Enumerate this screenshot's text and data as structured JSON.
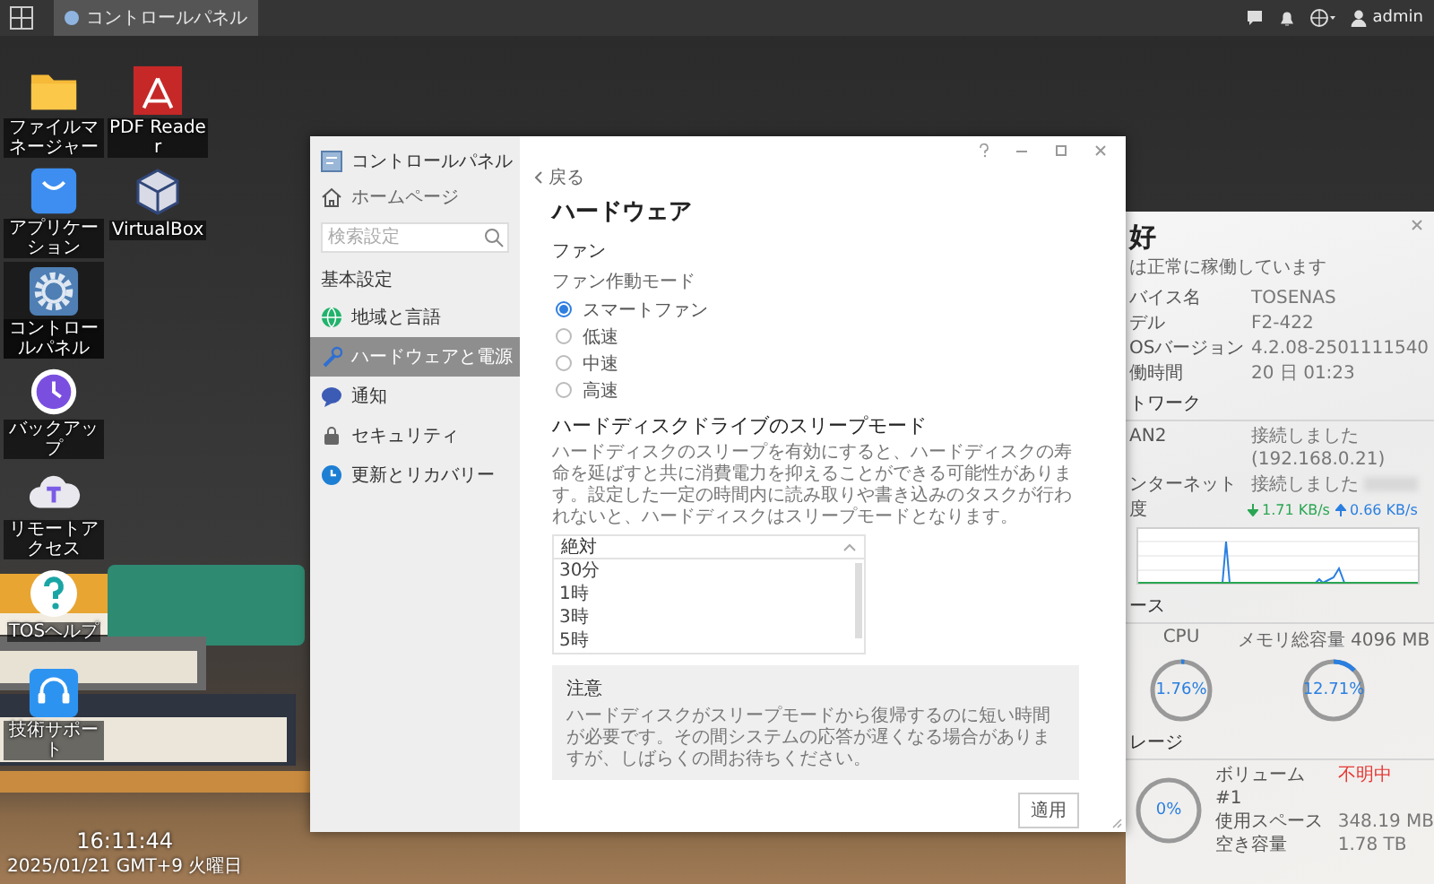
{
  "taskbar": {
    "open_app": "コントロールパネル",
    "user": "admin"
  },
  "desktop_icons": [
    {
      "label": "ファイルマネージャー",
      "kind": "folder",
      "selected": false
    },
    {
      "label": "アプリケーション",
      "kind": "store",
      "selected": false
    },
    {
      "label": "コントロールパネル",
      "kind": "gear",
      "selected": true
    },
    {
      "label": "バックアップ",
      "kind": "backup",
      "selected": false
    },
    {
      "label": "リモートアクセス",
      "kind": "cloud",
      "selected": false
    },
    {
      "label": "TOSヘルプ",
      "kind": "help",
      "selected": false
    },
    {
      "label": "技術サポート",
      "kind": "headset",
      "selected": false
    },
    {
      "label": "PDF Reader",
      "kind": "pdf",
      "selected": false
    },
    {
      "label": "VirtualBox",
      "kind": "cube",
      "selected": false
    }
  ],
  "clock": {
    "time": "16:11:44",
    "date": "2025/01/21 GMT+9 火曜日"
  },
  "control_panel": {
    "title": "コントロールパネル",
    "home": "ホームページ",
    "search_placeholder": "検索設定",
    "section": "基本設定",
    "nav": [
      {
        "label": "地域と言語",
        "kind": "globe",
        "selected": false
      },
      {
        "label": "ハードウェアと電源",
        "kind": "hardware",
        "selected": true
      },
      {
        "label": "通知",
        "kind": "chat",
        "selected": false
      },
      {
        "label": "セキュリティ",
        "kind": "lock",
        "selected": false
      },
      {
        "label": "更新とリカバリー",
        "kind": "update",
        "selected": false
      }
    ],
    "back": "戻る",
    "heading": "ハードウェア",
    "fan": {
      "title": "ファン",
      "mode_label": "ファン作動モード",
      "options": [
        {
          "label": "スマートファン",
          "selected": true
        },
        {
          "label": "低速",
          "selected": false
        },
        {
          "label": "中速",
          "selected": false
        },
        {
          "label": "高速",
          "selected": false
        }
      ]
    },
    "sleep": {
      "title": "ハードディスクドライブのスリープモード",
      "description": "ハードディスクのスリープを有効にすると、ハードディスクの寿命を延ばすと共に消費電力を抑えることができる可能性があります。設定した一定の時間内に読み取りや書き込みのタスクが行われないと、ハードディスクはスリープモードとなります。",
      "dropdown": {
        "value": "絶対",
        "expanded": true,
        "options": [
          "30分",
          "1時",
          "3時",
          "5時"
        ]
      }
    },
    "notice": {
      "title": "注意",
      "text": "ハードディスクがスリープモードから復帰するのに短い時間が必要です。その間システムの応答が遅くなる場合がありますが、しばらくの間お待ちください。"
    },
    "apply": "適用"
  },
  "status_widget": {
    "title": "好",
    "status": "は正常に稼働しています",
    "info": [
      {
        "label": "バイス名",
        "value": "TOSENAS"
      },
      {
        "label": "デル",
        "value": "F2-422"
      },
      {
        "label": "OSバージョン",
        "value": "4.2.08-2501111540"
      },
      {
        "label": "働時間",
        "value": "20 日 01:23"
      }
    ],
    "network": {
      "title": "トワーク",
      "rows": [
        {
          "label": "AN2",
          "value": "接続しました (192.168.0.21)",
          "blurred": false
        },
        {
          "label": "ンターネット",
          "value": "接続しました",
          "blurred": true
        }
      ],
      "speed_label": "度",
      "download": "1.71 KB/s",
      "upload": "0.66 KB/s"
    },
    "resources": {
      "title": "ース",
      "meters": [
        {
          "label": "CPU",
          "reading": "1.76%",
          "level": 0.0176
        },
        {
          "label": "メモリ総容量 4096 MB",
          "reading": "12.71%",
          "level": 0.1271
        }
      ]
    },
    "storage": {
      "title": "レージ",
      "reading": "0%",
      "rows": [
        {
          "label": "ボリューム #1",
          "value": "不明中",
          "kind": "alert"
        },
        {
          "label": "使用スペース",
          "value": "348.19 MB",
          "kind": "normal"
        },
        {
          "label": "空き容量",
          "value": "1.78 TB",
          "kind": "normal"
        }
      ]
    }
  }
}
